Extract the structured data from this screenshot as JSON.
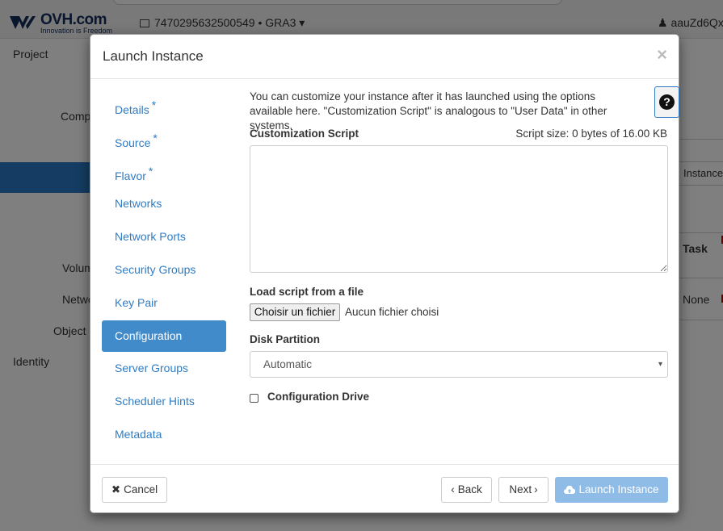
{
  "background": {
    "brand": "OVH.com",
    "brand_tagline": "Innovation is Freedom",
    "project_selector": "7470295632500549 • GRA3 ▾",
    "user": "aauZd6QxU",
    "nav_labels": {
      "project": "Project",
      "compute": "Comp",
      "volumes": "Volum",
      "network": "Netwo",
      "object_store": "Object S",
      "identity": "Identity"
    },
    "right_fragments": {
      "instance_btn": "Instance",
      "task_header": "Task",
      "none_cell": "None"
    }
  },
  "modal": {
    "title": "Launch Instance",
    "close_symbol": "×",
    "nav": [
      {
        "label": "Details",
        "required": "*"
      },
      {
        "label": "Source",
        "required": "*"
      },
      {
        "label": "Flavor",
        "required": "*"
      },
      {
        "label": "Networks",
        "required": ""
      },
      {
        "label": "Network Ports",
        "required": ""
      },
      {
        "label": "Security Groups",
        "required": ""
      },
      {
        "label": "Key Pair",
        "required": ""
      },
      {
        "label": "Configuration",
        "required": ""
      },
      {
        "label": "Server Groups",
        "required": ""
      },
      {
        "label": "Scheduler Hints",
        "required": ""
      },
      {
        "label": "Metadata",
        "required": ""
      }
    ],
    "active_nav": "Configuration",
    "intro": "You can customize your instance after it has launched using the options available here. \"Customization Script\" is analogous to \"User Data\" in other systems.",
    "help_symbol": "?",
    "script": {
      "label": "Customization Script",
      "size_text": "Script size: 0 bytes of 16.00 KB",
      "value": ""
    },
    "file": {
      "label": "Load script from a file",
      "button": "Choisir un fichier",
      "status": "Aucun fichier choisi"
    },
    "disk_partition": {
      "label": "Disk Partition",
      "selected": "Automatic",
      "caret": "▾"
    },
    "config_drive": {
      "label": "Configuration Drive",
      "checked": false
    },
    "footer": {
      "cancel": "Cancel",
      "back": "Back",
      "next": "Next",
      "launch": "Launch Instance"
    }
  },
  "colors": {
    "link_blue": "#2f7cc4",
    "active_blue": "#428bca",
    "launch_disabled": "#8fbce6",
    "ovh_navy": "#122e5c"
  }
}
